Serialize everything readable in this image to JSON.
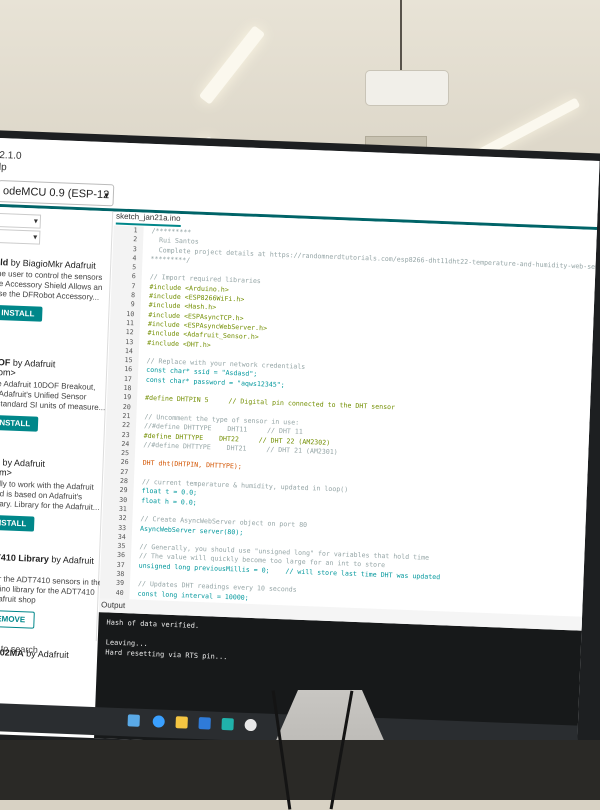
{
  "menubar": {
    "version": "2.1.0",
    "help": "lp"
  },
  "toolbar": {
    "board": "odeMCU 0.9 (ESP-12 ...",
    "board_chevron": "▾"
  },
  "libpanel": {
    "selects": [
      "▾",
      "▾"
    ],
    "items": [
      {
        "title": "eld",
        "by": " by BiagioMkr Adafruit",
        "desc": "the user to control the sensors\nhe Accessory Shield Allows an\nuse the DFRobot Accessory...",
        "button": "INSTALL"
      },
      {
        "title": "DOF",
        "by": " by Adafruit\n.com>",
        "desc": "the Adafruit 10DOF Breakout,\nof Adafruit's Unified Sensor\ne standard SI units of measure...",
        "button": "INSTALL"
      },
      {
        "title": "OF",
        "by": " by Adafruit\n.com>",
        "desc": "fically to work with the Adafruit\n, and is based on Adafruit's\nLibrary. Library for the Adafruit...",
        "button": "INSTALL"
      },
      {
        "title": "DT7410 Library",
        "by": " by Adafruit\nd",
        "desc": "ry for the ADT7410 sensors in the\nArduino library for the ADT7410\ne Adafruit shop",
        "button": "REMOVE"
      },
      {
        "title": "AGS02MA",
        "by": " by Adafruit",
        "desc": "",
        "button": ""
      }
    ],
    "search": "here to search"
  },
  "editor": {
    "tab": "sketch_jan21a.ino",
    "lines": [
      {
        "n": "1",
        "text": "/*********",
        "cls": "c-comment"
      },
      {
        "n": "2",
        "text": "  Rui Santos",
        "cls": "c-comment"
      },
      {
        "n": "3",
        "text": "  Complete project details at https://randomnerdtutorials.com/esp8266-dht11dht22-temperature-and-humidity-web-server-with-arduino-ide/",
        "cls": "c-comment"
      },
      {
        "n": "4",
        "text": "*********/",
        "cls": "c-comment"
      },
      {
        "n": "5",
        "text": "",
        "cls": ""
      },
      {
        "n": "6",
        "text": "// Import required libraries",
        "cls": "c-comment"
      },
      {
        "n": "7",
        "text": "#include <Arduino.h>",
        "cls": "c-macro"
      },
      {
        "n": "8",
        "text": "#include <ESP8266WiFi.h>",
        "cls": "c-macro"
      },
      {
        "n": "9",
        "text": "#include <Hash.h>",
        "cls": "c-macro"
      },
      {
        "n": "10",
        "text": "#include <ESPAsyncTCP.h>",
        "cls": "c-macro"
      },
      {
        "n": "11",
        "text": "#include <ESPAsyncWebServer.h>",
        "cls": "c-macro"
      },
      {
        "n": "12",
        "text": "#include <Adafruit_Sensor.h>",
        "cls": "c-macro"
      },
      {
        "n": "13",
        "text": "#include <DHT.h>",
        "cls": "c-macro"
      },
      {
        "n": "14",
        "text": "",
        "cls": ""
      },
      {
        "n": "15",
        "text": "// Replace with your network credentials",
        "cls": "c-comment"
      },
      {
        "n": "16",
        "text": "const char* ssid = \"Asdasd\";",
        "cls": "c-kw"
      },
      {
        "n": "17",
        "text": "const char* password = \"aqws12345\";",
        "cls": "c-kw"
      },
      {
        "n": "18",
        "text": "",
        "cls": ""
      },
      {
        "n": "19",
        "text": "#define DHTPIN 5     // Digital pin connected to the DHT sensor",
        "cls": "c-macro"
      },
      {
        "n": "20",
        "text": "",
        "cls": ""
      },
      {
        "n": "21",
        "text": "// Uncomment the type of sensor in use:",
        "cls": "c-comment"
      },
      {
        "n": "22",
        "text": "//#define DHTTYPE    DHT11     // DHT 11",
        "cls": "c-comment"
      },
      {
        "n": "23",
        "text": "#define DHTTYPE    DHT22     // DHT 22 (AM2302)",
        "cls": "c-macro"
      },
      {
        "n": "24",
        "text": "//#define DHTTYPE    DHT21     // DHT 21 (AM2301)",
        "cls": "c-comment"
      },
      {
        "n": "25",
        "text": "",
        "cls": ""
      },
      {
        "n": "26",
        "text": "DHT dht(DHTPIN, DHTTYPE);",
        "cls": "c-fn"
      },
      {
        "n": "27",
        "text": "",
        "cls": ""
      },
      {
        "n": "28",
        "text": "// current temperature & humidity, updated in loop()",
        "cls": "c-comment"
      },
      {
        "n": "29",
        "text": "float t = 0.0;",
        "cls": "c-kw"
      },
      {
        "n": "30",
        "text": "float h = 0.0;",
        "cls": "c-kw"
      },
      {
        "n": "31",
        "text": "",
        "cls": ""
      },
      {
        "n": "32",
        "text": "// Create AsyncWebServer object on port 80",
        "cls": "c-comment"
      },
      {
        "n": "33",
        "text": "AsyncWebServer server(80);",
        "cls": "c-kw"
      },
      {
        "n": "34",
        "text": "",
        "cls": ""
      },
      {
        "n": "35",
        "text": "// Generally, you should use \"unsigned long\" for variables that hold time",
        "cls": "c-comment"
      },
      {
        "n": "36",
        "text": "// The value will quickly become too large for an int to store",
        "cls": "c-comment"
      },
      {
        "n": "37",
        "text": "unsigned long previousMillis = 0;    // will store last time DHT was updated",
        "cls": "c-kw"
      },
      {
        "n": "38",
        "text": "",
        "cls": ""
      },
      {
        "n": "39",
        "text": "// Updates DHT readings every 10 seconds",
        "cls": "c-comment"
      },
      {
        "n": "40",
        "text": "const long interval = 10000;",
        "cls": "c-kw"
      },
      {
        "n": "41",
        "text": "",
        "cls": ""
      }
    ]
  },
  "output": {
    "label": "Output",
    "lines": [
      "Hash of data verified.",
      "",
      "Leaving...",
      "Hard resetting via RTS pin..."
    ]
  }
}
